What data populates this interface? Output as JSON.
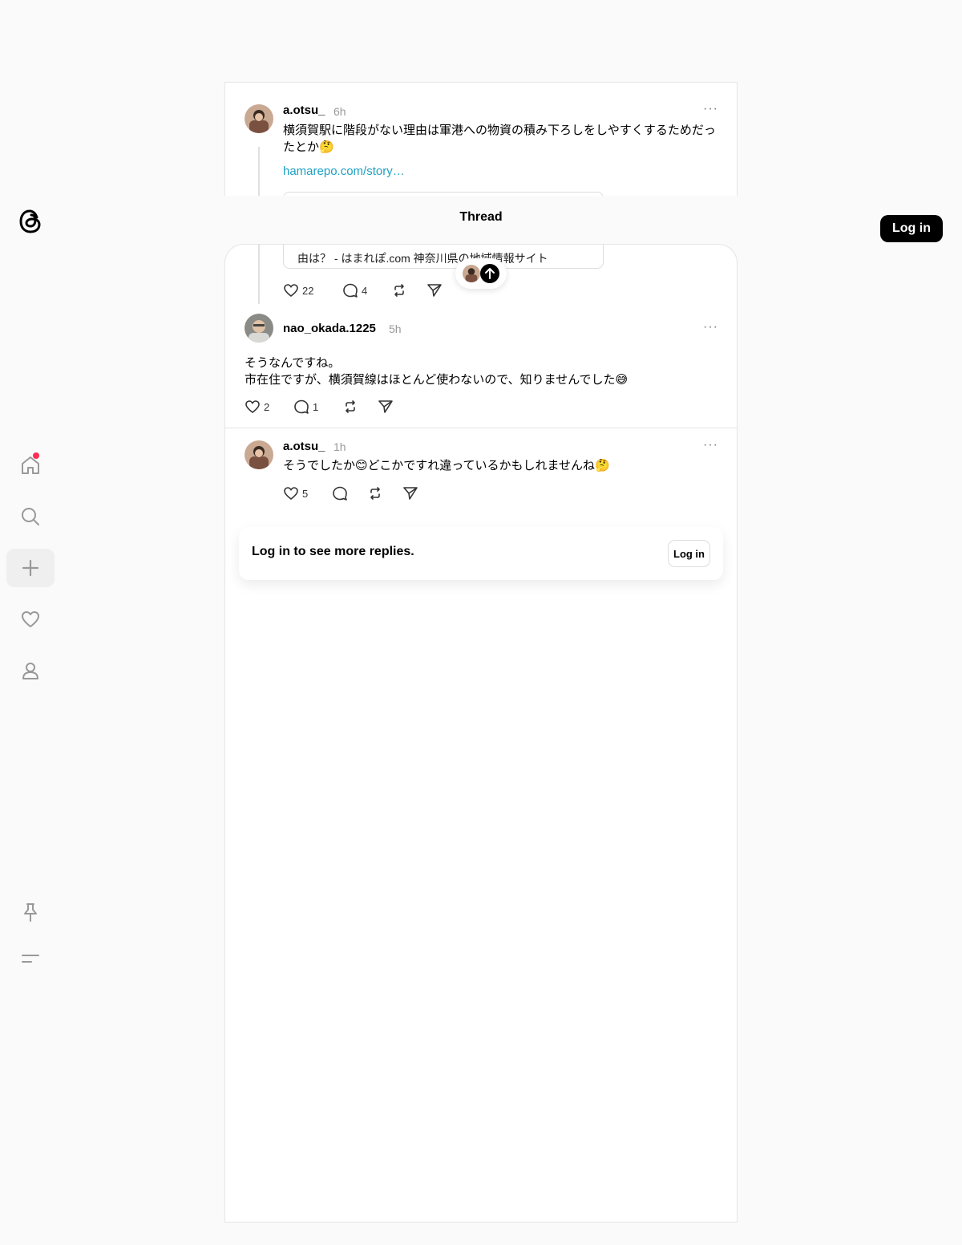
{
  "header": {
    "title": "Thread",
    "login_label": "Log in"
  },
  "colors": {
    "link": "#1da1c4",
    "notification_dot": "#ff2c55"
  },
  "nav": [
    "home-icon",
    "search-icon",
    "plus-icon",
    "heart-icon",
    "person-icon",
    "pin-icon",
    "menu-icon"
  ],
  "post": {
    "username": "a.otsu_",
    "time": "6h",
    "text_line1": "横須賀駅に階段がない理由は軍港への物資の積み下ろしをしやすくするためだっ",
    "text_line2": "たとか🤔",
    "link": "hamarepo.com/story…",
    "card_text": "由は？ - はまれぽ.com 神奈川県の地域情報サイト",
    "likes": "22",
    "replies": "4"
  },
  "replies": [
    {
      "username": "nao_okada.1225",
      "time": "5h",
      "text_line1": "そうなんですね。",
      "text_line2": "市在住ですが、横須賀線はほとんど使わないので、知りませんでした😅",
      "likes": "2",
      "replies": "1"
    },
    {
      "username": "a.otsu_",
      "time": "1h",
      "text_line1": "そうでしたか😊どこかですれ違っているかもしれませんね🤔",
      "likes": "5"
    }
  ],
  "login_prompt": {
    "text": "Log in to see more replies.",
    "button": "Log in"
  }
}
